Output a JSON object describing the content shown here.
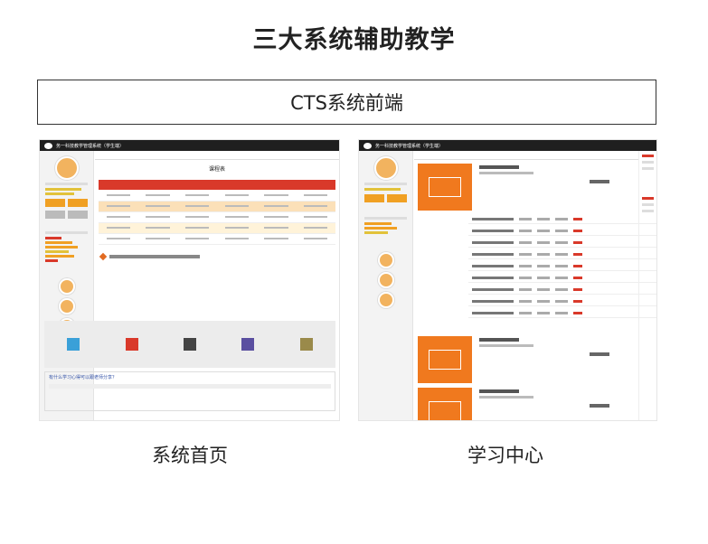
{
  "header": {
    "title": "三大系统辅助教学"
  },
  "section": {
    "label": "CTS系统前端"
  },
  "screenshots": [
    {
      "caption": "系统首页",
      "app_title": "务一科技教学管理系统（学生端）",
      "schedule_title": "课程表",
      "handwriting": "有什么学习心得可以跟老师分享？"
    },
    {
      "caption": "学习中心",
      "app_title": "务一科技教学管理系统（学生端）"
    }
  ],
  "colors": {
    "accent_red": "#d9392a",
    "accent_orange": "#f0791e",
    "dark_bar": "#1f1f1f"
  }
}
